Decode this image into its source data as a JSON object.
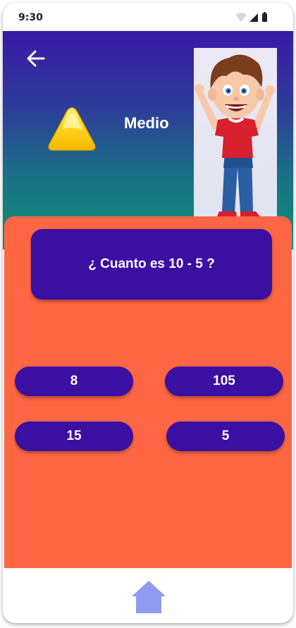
{
  "status_bar": {
    "time": "9:30"
  },
  "header": {
    "level_label": "Medio"
  },
  "question": {
    "text": "¿ Cuanto es 10 - 5 ?"
  },
  "answers": [
    "8",
    "105",
    "15",
    "5"
  ],
  "nav": {
    "home_icon": "home-icon"
  },
  "colors": {
    "header_top": "#3a1aa6",
    "header_bottom": "#0e9178",
    "card": "#ff6644",
    "button": "#3a0fa1",
    "home": "#8f9af0"
  }
}
